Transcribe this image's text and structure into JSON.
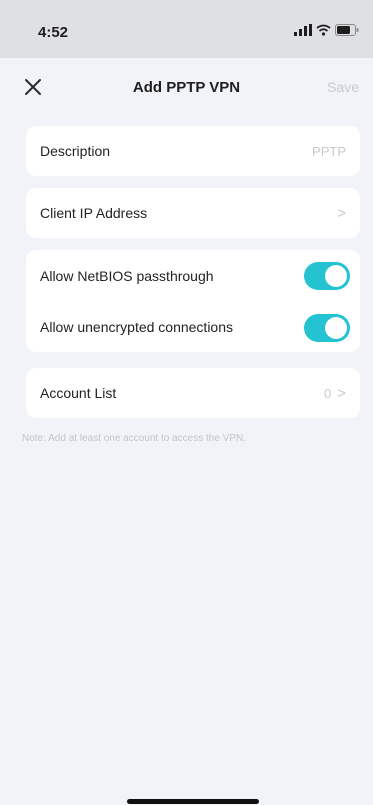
{
  "status_bar": {
    "time": "4:52",
    "icons": [
      "cellular-signal-icon",
      "wifi-icon",
      "battery-icon"
    ]
  },
  "nav": {
    "close_icon": "close-icon",
    "title": "Add PPTP VPN",
    "save_label": "Save"
  },
  "description": {
    "label": "Description",
    "placeholder": "PPTP"
  },
  "client_ip": {
    "label": "Client IP Address",
    "chevron": ">"
  },
  "toggles": [
    {
      "label": "Allow NetBIOS passthrough",
      "on": true
    },
    {
      "label": "Allow unencrypted connections",
      "on": true
    }
  ],
  "account_list": {
    "label": "Account List",
    "count": "0",
    "chevron": ">"
  },
  "note": "Note: Add at least one account to access the VPN.",
  "colors": {
    "accent": "#25c3d1",
    "background": "#f2f3f8",
    "card": "#ffffff",
    "muted_text": "#c8c9ce"
  }
}
